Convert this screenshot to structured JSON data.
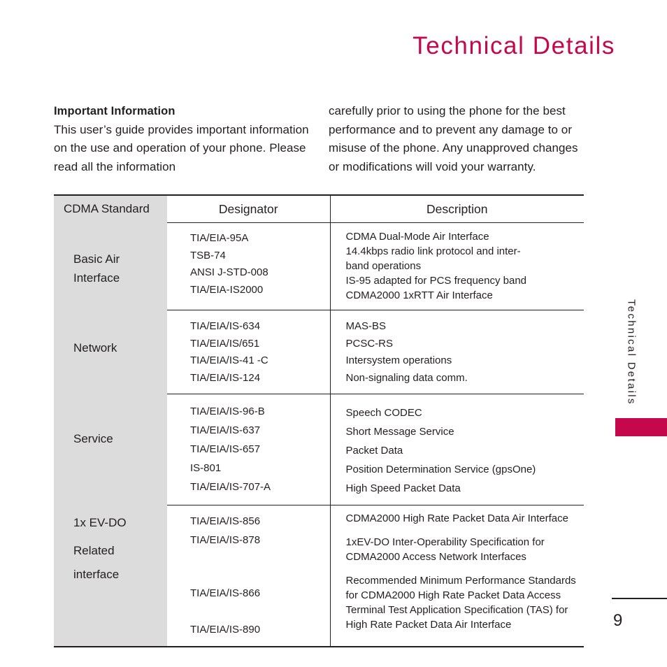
{
  "page": {
    "title": "Technical Details",
    "number": "9",
    "side_tab_label": "Technical Details",
    "accent_color": "#c4084b",
    "standard_column_bg": "#dcdcdc",
    "text_color": "#231f20"
  },
  "intro": {
    "heading": "Important Information",
    "left_body": "This user’s guide provides important information on the use and operation of your phone. Please read all the information",
    "right_body": "carefully prior to using the phone for the best performance and to prevent any damage to or misuse of the phone. Any unapproved changes or modifications will void your warranty."
  },
  "table": {
    "headers": {
      "standard": "CDMA Standard",
      "designator": "Designator",
      "description": "Description"
    },
    "rows": [
      {
        "standard_lines": [
          "Basic Air",
          "Interface"
        ],
        "designators": [
          "TIA/EIA-95A",
          "TSB-74",
          "ANSI J-STD-008",
          "TIA/EIA-IS2000"
        ],
        "descriptions": [
          "CDMA Dual-Mode Air Interface",
          "14.4kbps radio link protocol and inter-",
          "band operations",
          "IS-95 adapted for PCS frequency band",
          "CDMA2000 1xRTT Air Interface"
        ]
      },
      {
        "standard_lines": [
          "Network"
        ],
        "designators": [
          "TIA/EIA/IS-634",
          "TIA/EIA/IS/651",
          "TIA/EIA/IS-41 -C",
          "TIA/EIA/IS-124"
        ],
        "descriptions": [
          "MAS-BS",
          "PCSC-RS",
          "Intersystem operations",
          "Non-signaling data comm."
        ]
      },
      {
        "standard_lines": [
          "Service"
        ],
        "designators": [
          "TIA/EIA/IS-96-B",
          "TIA/EIA/IS-637",
          "TIA/EIA/IS-657",
          "IS-801",
          "TIA/EIA/IS-707-A"
        ],
        "descriptions": [
          "Speech CODEC",
          "Short Message Service",
          "Packet Data",
          "Position Determination Service (gpsOne)",
          "High Speed Packet Data"
        ]
      },
      {
        "standard_lines": [
          "1x EV-DO",
          "Related",
          "interface"
        ],
        "designators": [
          "TIA/EIA/IS-856",
          "TIA/EIA/IS-878",
          "",
          "",
          "TIA/EIA/IS-866",
          "",
          "TIA/EIA/IS-890"
        ],
        "description_paragraphs": [
          [
            "CDMA2000 High Rate Packet Data Air Interface"
          ],
          [
            "1xEV-DO Inter-Operability Specification for",
            "CDMA2000 Access Network Interfaces"
          ],
          [
            "Recommended Minimum Performance Standards",
            "for CDMA2000 High Rate Packet Data Access",
            "Terminal Test Application Specification (TAS) for",
            "High Rate Packet Data Air Interface"
          ]
        ]
      }
    ]
  }
}
